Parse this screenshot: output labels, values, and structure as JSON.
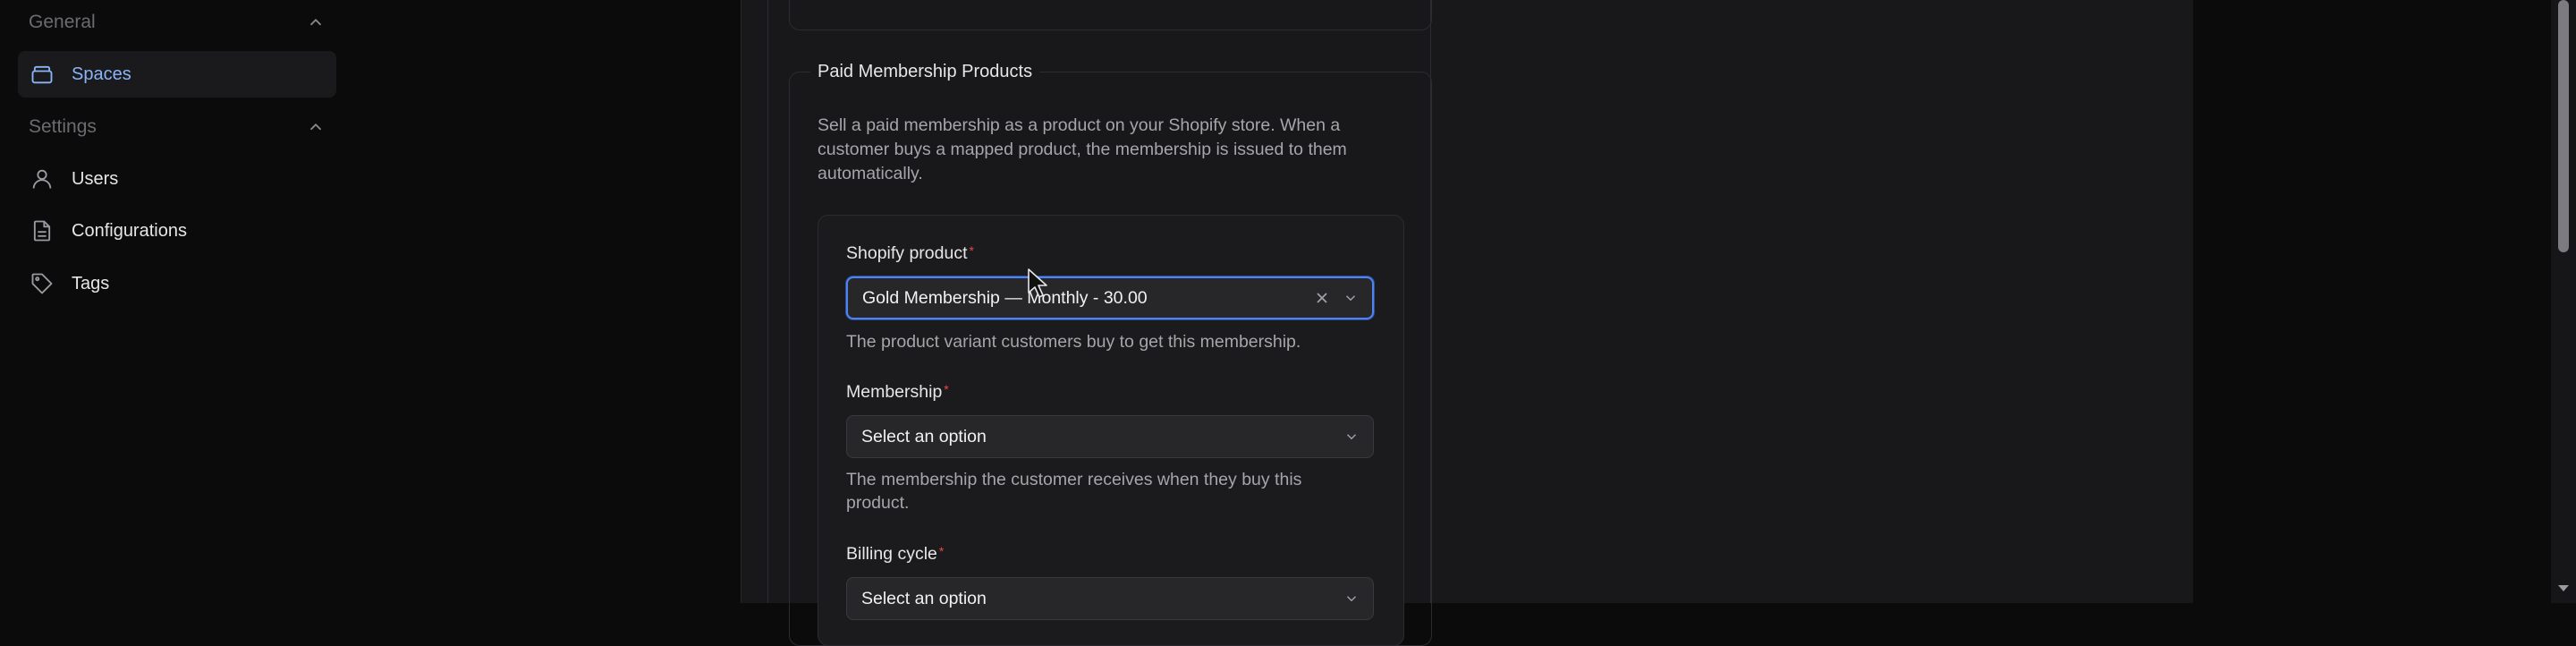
{
  "sidebar": {
    "groups": [
      {
        "label": "General",
        "items": [
          {
            "label": "Spaces",
            "icon": "layers-icon",
            "active": true
          }
        ]
      },
      {
        "label": "Settings",
        "items": [
          {
            "label": "Users",
            "icon": "user-icon"
          },
          {
            "label": "Configurations",
            "icon": "file-icon"
          },
          {
            "label": "Tags",
            "icon": "tag-icon"
          }
        ]
      }
    ]
  },
  "section": {
    "title": "Paid Membership Products",
    "description": "Sell a paid membership as a product on your Shopify store. When a customer buys a mapped product, the membership is issued to them automatically."
  },
  "form": {
    "shopify_product": {
      "label": "Shopify product",
      "required_mark": "*",
      "value": "Gold Membership — Monthly - 30.00",
      "help": "The product variant customers buy to get this membership."
    },
    "membership": {
      "label": "Membership",
      "required_mark": "*",
      "placeholder": "Select an option",
      "help": "The membership the customer receives when they buy this product."
    },
    "billing_cycle": {
      "label": "Billing cycle",
      "required_mark": "*",
      "placeholder": "Select an option"
    }
  },
  "colors": {
    "accent": "#8ab4f8",
    "focus_ring": "#4f83f1",
    "required": "#ef4444",
    "background": "#0b0b0c",
    "panel": "#18181a"
  }
}
